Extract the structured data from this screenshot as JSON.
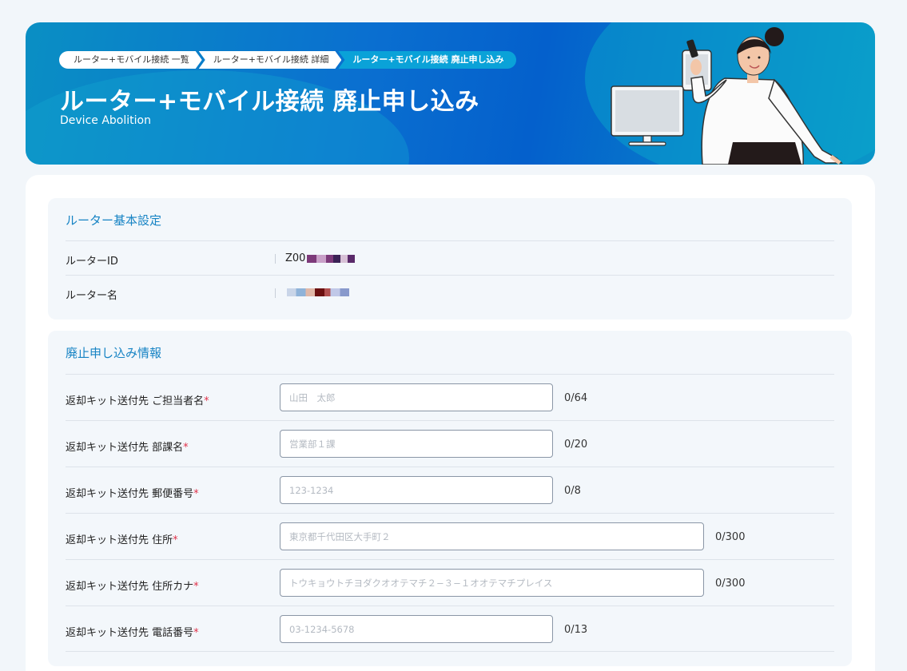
{
  "header": {
    "breadcrumbs": [
      "ルーター+モバイル接続 一覧",
      "ルーター+モバイル接続 詳細",
      "ルーター+モバイル接続 廃止申し込み"
    ],
    "title": "ルーター+モバイル接続 廃止申し込み",
    "subtitle": "Device Abolition"
  },
  "router_settings": {
    "section_title": "ルーター基本設定",
    "router_id_label": "ルーターID",
    "router_id_value": "Z00",
    "router_name_label": "ルーター名"
  },
  "abolition_info": {
    "section_title": "廃止申し込み情報",
    "fields": [
      {
        "label": "返却キット送付先 ご担当者名",
        "required": "*",
        "placeholder": "山田　太郎",
        "counter": "0/64"
      },
      {
        "label": "返却キット送付先 部課名",
        "required": "*",
        "placeholder": "営業部１課",
        "counter": "0/20"
      },
      {
        "label": "返却キット送付先 郵便番号",
        "required": "*",
        "placeholder": "123-1234",
        "counter": "0/8"
      },
      {
        "label": "返却キット送付先 住所",
        "required": "*",
        "placeholder": "東京都千代田区大手町２",
        "counter": "0/300"
      },
      {
        "label": "返却キット送付先 住所カナ",
        "required": "*",
        "placeholder": "トウキョウトチヨダクオオテマチ２−３−１オオテマチプレイス",
        "counter": "0/300"
      },
      {
        "label": "返却キット送付先 電話番号",
        "required": "*",
        "placeholder": "03-1234-5678",
        "counter": "0/13"
      }
    ]
  },
  "colors": {
    "accent": "#1683c4",
    "required": "#e0324a",
    "hero_blue": "#0460cc"
  }
}
